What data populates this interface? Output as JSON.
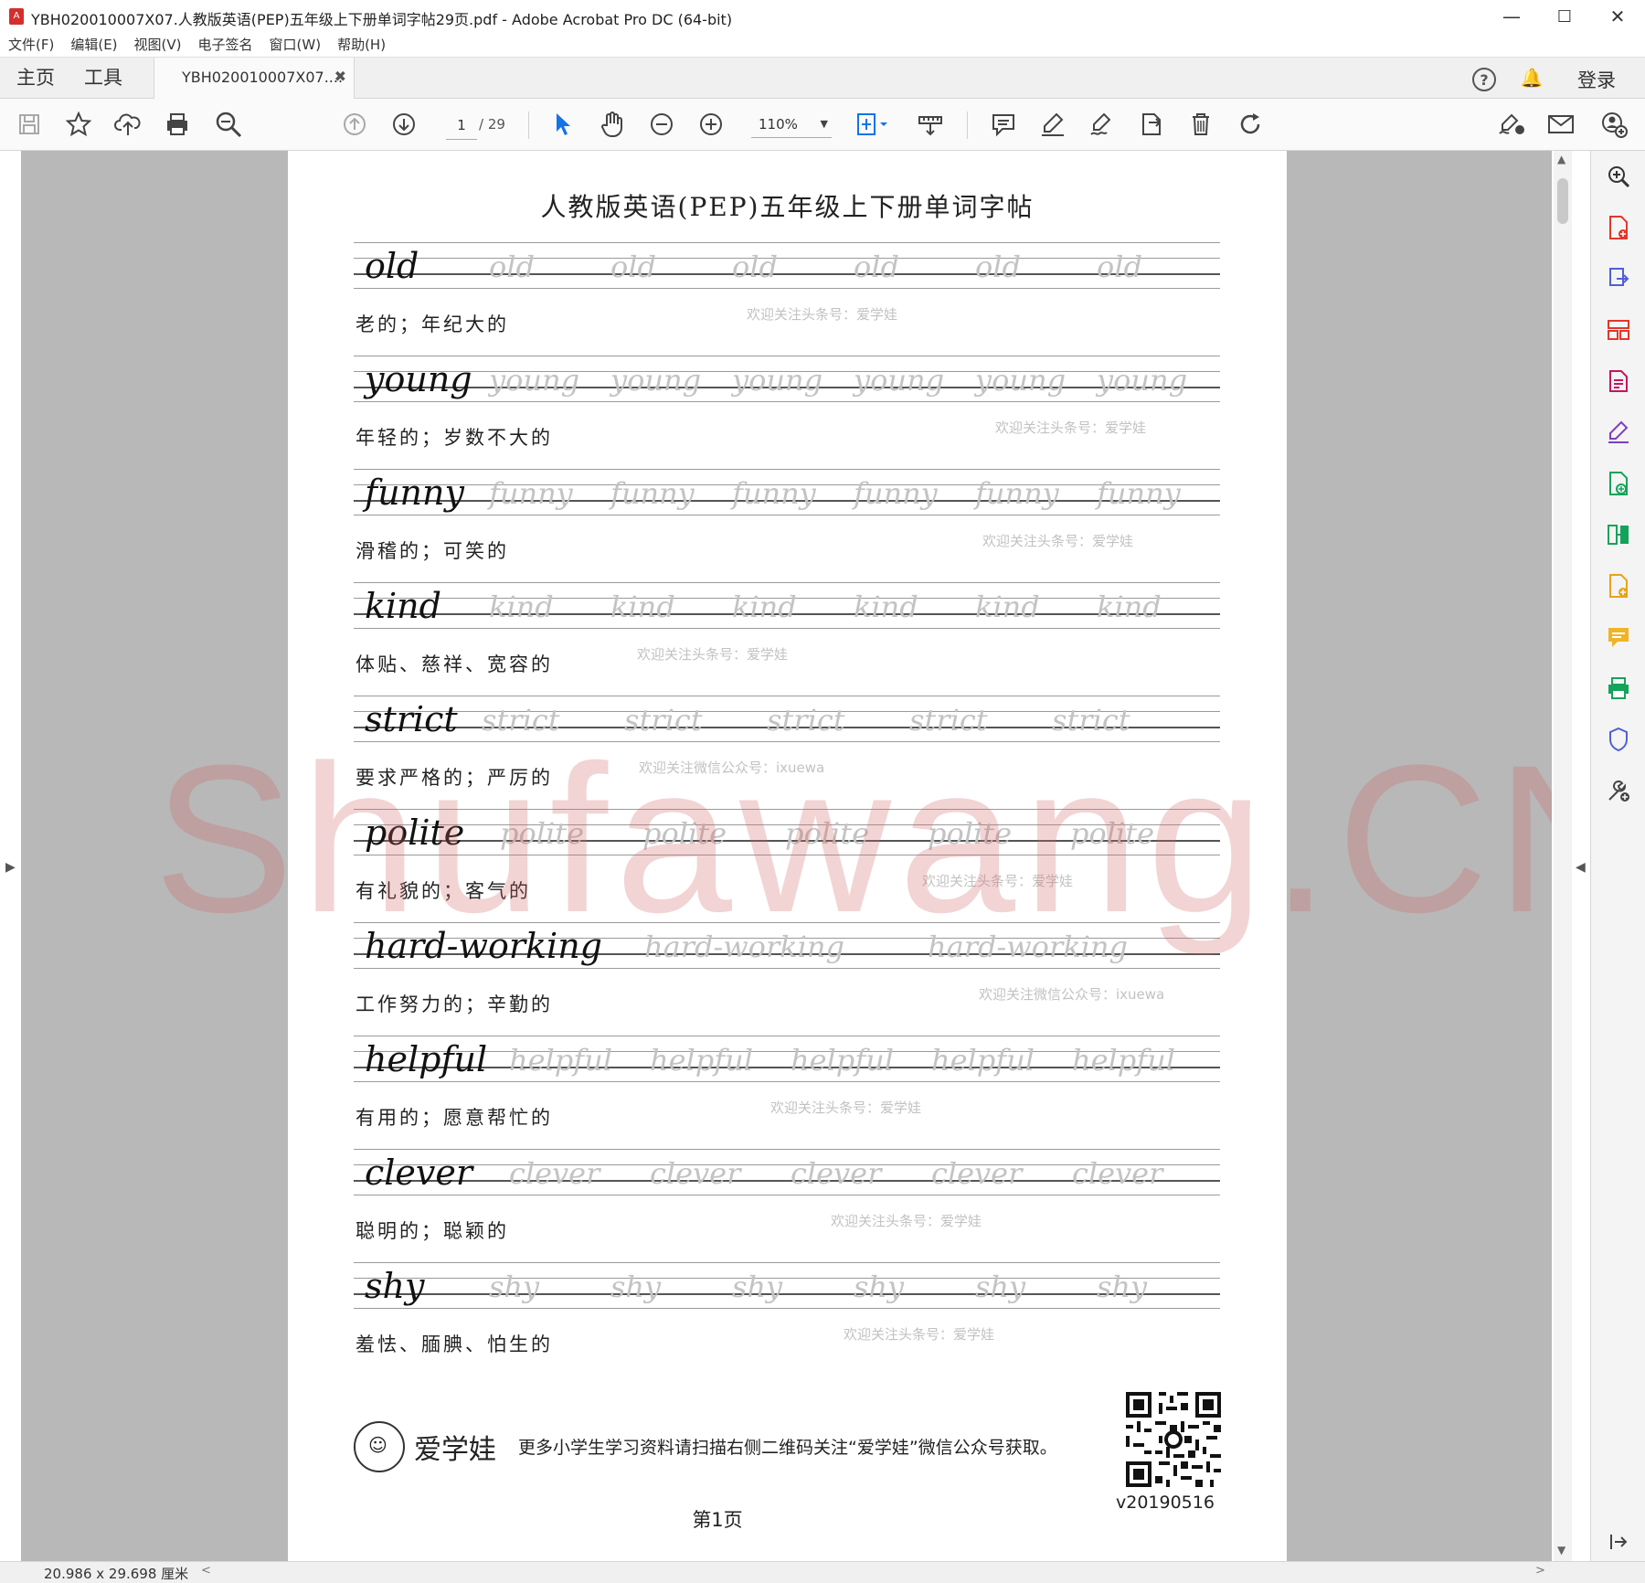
{
  "window": {
    "title": "YBH020010007X07.人教版英语(PEP)五年级上下册单词字帖29页.pdf - Adobe Acrobat Pro DC (64-bit)",
    "minimize": "—",
    "maximize": "☐",
    "close": "✕"
  },
  "menu": [
    "文件(F)",
    "编辑(E)",
    "视图(V)",
    "电子签名",
    "窗口(W)",
    "帮助(H)"
  ],
  "tabs": {
    "home": "主页",
    "tools": "工具",
    "document": "YBH020010007X07....",
    "close_glyph": "✖",
    "help_icon": "?",
    "bell_icon": "🔔",
    "login": "登录"
  },
  "toolbar": {
    "current_page": "1",
    "total_pages": "/ 29",
    "zoom": "110%",
    "zoom_caret": "▼"
  },
  "document": {
    "title": "人教版英语(PEP)五年级上下册单词字帖",
    "words": [
      {
        "word": "old",
        "meaning": "老的；年纪大的",
        "note": "欢迎关注头条号：爱学娃"
      },
      {
        "word": "young",
        "meaning": "年轻的；岁数不大的",
        "note": "欢迎关注头条号：爱学娃"
      },
      {
        "word": "funny",
        "meaning": "滑稽的；可笑的",
        "note": "欢迎关注头条号：爱学娃"
      },
      {
        "word": "kind",
        "meaning": "体贴、慈祥、宽容的",
        "note": "欢迎关注头条号：爱学娃"
      },
      {
        "word": "strict",
        "meaning": "要求严格的；严厉的",
        "note": "欢迎关注微信公众号：ixuewa"
      },
      {
        "word": "polite",
        "meaning": "有礼貌的；客气的",
        "note": "欢迎关注头条号：爱学娃"
      },
      {
        "word": "hard-working",
        "meaning": "工作努力的；辛勤的",
        "note": "欢迎关注微信公众号：ixuewa"
      },
      {
        "word": "helpful",
        "meaning": "有用的；愿意帮忙的",
        "note": "欢迎关注头条号：爱学娃"
      },
      {
        "word": "clever",
        "meaning": "聪明的；聪颖的",
        "note": "欢迎关注头条号：爱学娃"
      },
      {
        "word": "shy",
        "meaning": "羞怯、腼腆、怕生的",
        "note": "欢迎关注头条号：爱学娃"
      }
    ],
    "brand": "爱学娃",
    "footer_text": "更多小学生学习资料请扫描右侧二维码关注“爱学娃”微信公众号获取。",
    "version": "v20190516",
    "page_label": "第1页",
    "big_watermark": "Shufawang.CN"
  },
  "status": {
    "page_size": "20.986 x 29.698 厘米"
  },
  "colors": {
    "accent_blue": "#1473e6",
    "acrobat_red": "#d32f2f",
    "trace_gray": "#c3c3c3"
  }
}
